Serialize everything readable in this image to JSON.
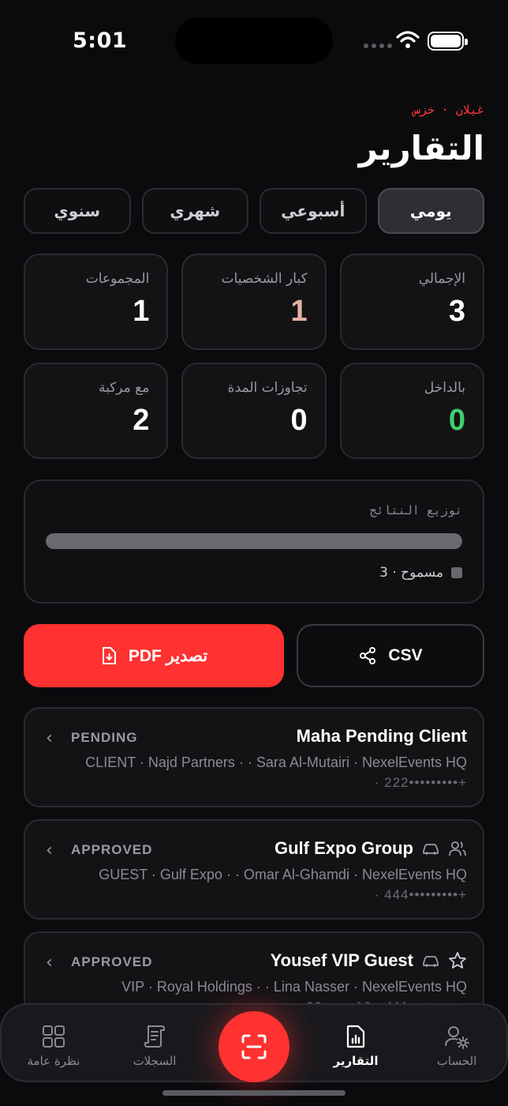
{
  "status_bar": {
    "time": "5:01"
  },
  "header": {
    "breadcrumb": "غيلان · خزس",
    "title": "التقارير"
  },
  "periods": [
    {
      "label": "يومي",
      "active": true
    },
    {
      "label": "أسبوعي",
      "active": false
    },
    {
      "label": "شهري",
      "active": false
    },
    {
      "label": "سنوي",
      "active": false
    }
  ],
  "stats": [
    {
      "label": "الإجمالي",
      "value": "3",
      "color": "#ffffff"
    },
    {
      "label": "كبار الشخصيات",
      "value": "1",
      "color": "#e7b2a4"
    },
    {
      "label": "المجموعات",
      "value": "1",
      "color": "#ffffff"
    },
    {
      "label": "بالداخل",
      "value": "0",
      "color": "#3ecf6e"
    },
    {
      "label": "تجاوزات المدة",
      "value": "0",
      "color": "#ffffff"
    },
    {
      "label": "مع مركبة",
      "value": "2",
      "color": "#ffffff"
    }
  ],
  "distribution": {
    "title": "توزيع النتائج",
    "fill_fraction": 1.0,
    "legend": "مسموح · 3"
  },
  "actions": {
    "csv_label": "CSV",
    "pdf_label": "تصدير PDF"
  },
  "records": [
    {
      "name": "Maha Pending Client",
      "status": "PENDING",
      "line1": "CLIENT · Najd Partners · · Sara Al-Mutairi · NexelEvents HQ",
      "line2": "· 222•••••••••+",
      "icons": []
    },
    {
      "name": "Gulf Expo Group",
      "status": "APPROVED",
      "line1": "GUEST · Gulf Expo · · Omar Al-Ghamdi · NexelEvents HQ",
      "line2": "· 444•••••••••+",
      "icons": [
        "car-icon",
        "group-icon"
      ]
    },
    {
      "name": "Yousef VIP Guest",
      "status": "APPROVED",
      "line1": "VIP · Royal Holdings · · Lina Nasser · NexelEvents HQ",
      "line2": "32••••••10 · 111•••••••••+",
      "icons": [
        "car-icon",
        "star-icon"
      ]
    }
  ],
  "tabs": {
    "overview": "نظرة عامة",
    "logs": "السجلات",
    "reports": "التقارير",
    "account": "الحساب"
  },
  "colors": {
    "accent": "#ff3131",
    "success": "#3ecf6e",
    "vip": "#e7b2a4"
  }
}
